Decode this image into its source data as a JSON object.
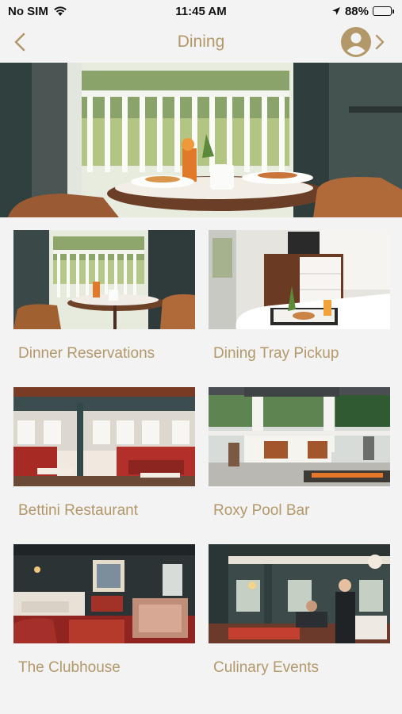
{
  "status_bar": {
    "carrier": "No SIM",
    "time": "11:45 AM",
    "battery": "88%",
    "battery_level": 0.88
  },
  "nav": {
    "title": "Dining",
    "back_icon": "chevron-left-icon",
    "profile_icon": "user-circle-icon"
  },
  "colors": {
    "accent": "#b39869",
    "background": "#f3f3f3",
    "battery_green": "#3fc23a"
  },
  "hero": {
    "image": "restaurant-window-table-photo"
  },
  "cards": [
    {
      "label": "Dinner Reservations",
      "image": "window-table-breakfast-photo"
    },
    {
      "label": "Dining Tray Pickup",
      "image": "room-breakfast-tray-photo"
    },
    {
      "label": "Bettini Restaurant",
      "image": "red-booth-restaurant-photo"
    },
    {
      "label": "Roxy Pool Bar",
      "image": "outdoor-pool-bar-photo"
    },
    {
      "label": "The Clubhouse",
      "image": "clubhouse-lounge-photo"
    },
    {
      "label": "Culinary Events",
      "image": "dining-room-event-photo"
    }
  ]
}
